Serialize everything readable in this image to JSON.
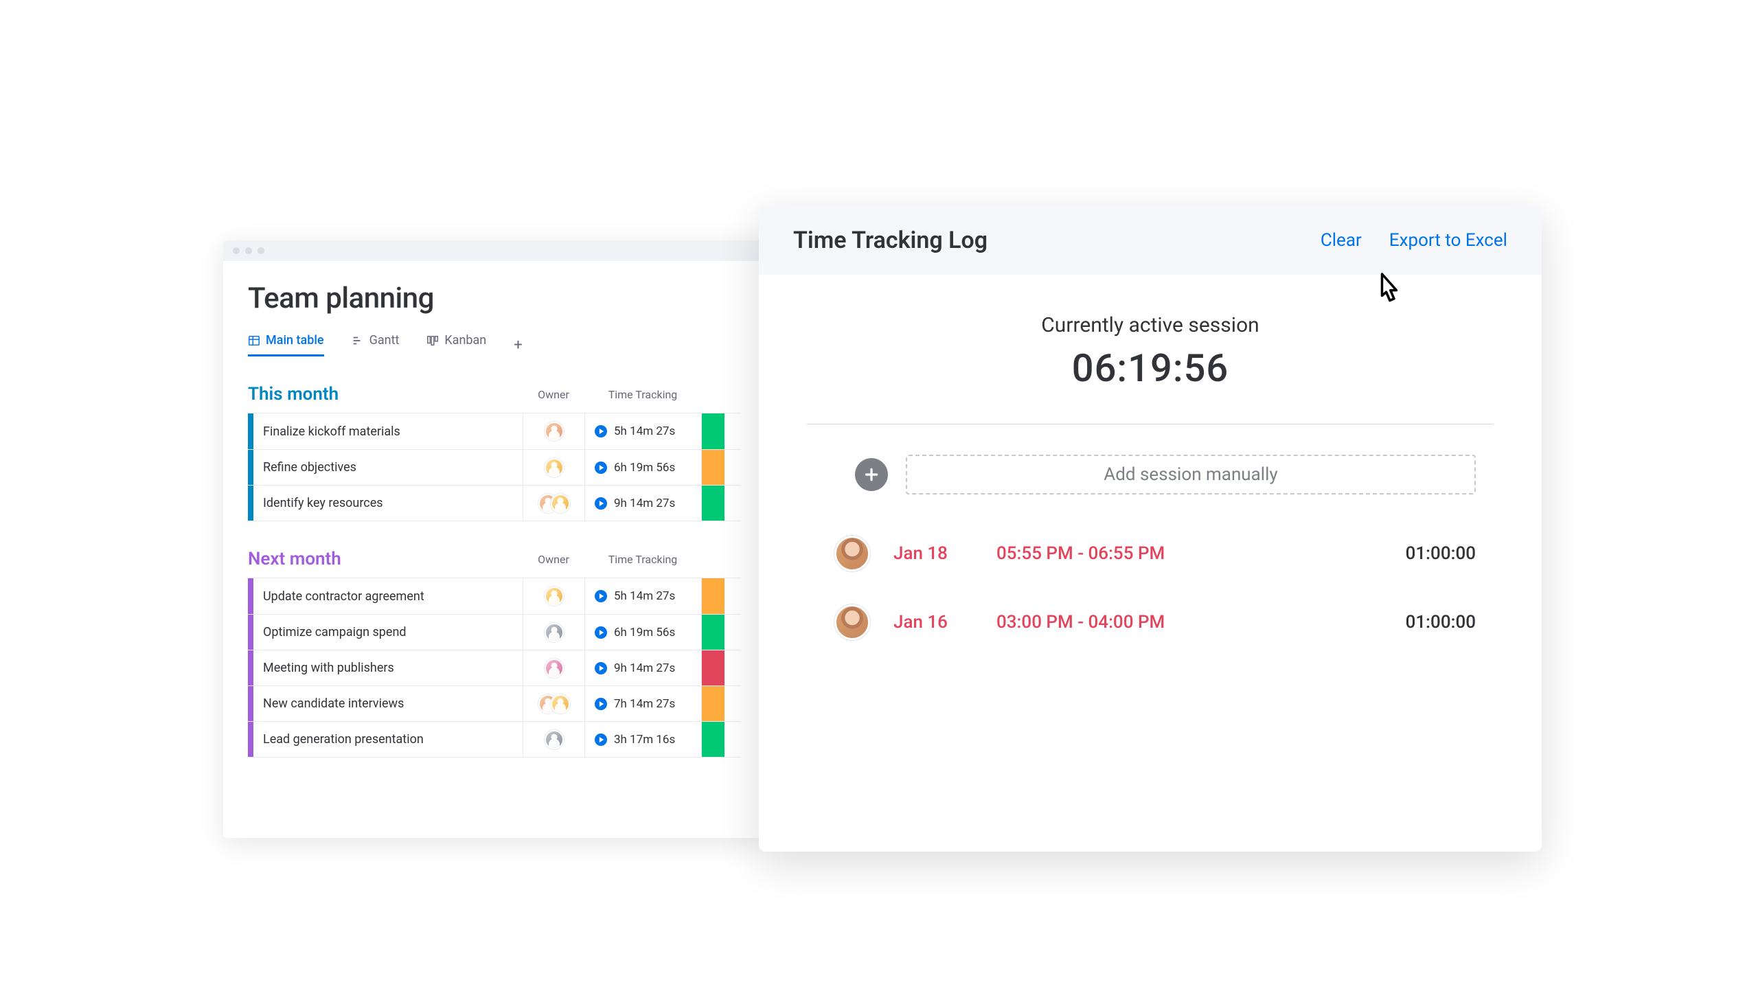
{
  "board": {
    "title": "Team planning",
    "tabs": {
      "main": "Main table",
      "gantt": "Gantt",
      "kanban": "Kanban"
    },
    "columns": {
      "owner": "Owner",
      "time_tracking": "Time Tracking"
    },
    "groups": [
      {
        "id": "this",
        "title": "This month",
        "rows": [
          {
            "name": "Finalize kickoff materials",
            "tt": "5h 14m 27s",
            "owners": [
              "c1"
            ],
            "status": "green"
          },
          {
            "name": "Refine objectives",
            "tt": "6h 19m 56s",
            "owners": [
              "c3"
            ],
            "status": "orange"
          },
          {
            "name": "Identify key resources",
            "tt": "9h 14m 27s",
            "owners": [
              "c1",
              "c3"
            ],
            "status": "green"
          }
        ]
      },
      {
        "id": "next",
        "title": "Next month",
        "rows": [
          {
            "name": "Update contractor agreement",
            "tt": "5h 14m 27s",
            "owners": [
              "c3"
            ],
            "status": "orange"
          },
          {
            "name": "Optimize campaign spend",
            "tt": "6h 19m 56s",
            "owners": [
              "c5"
            ],
            "status": "green"
          },
          {
            "name": "Meeting with publishers",
            "tt": "9h 14m 27s",
            "owners": [
              "c6"
            ],
            "status": "red"
          },
          {
            "name": "New candidate interviews",
            "tt": "7h 14m 27s",
            "owners": [
              "c1",
              "c3"
            ],
            "status": "orange"
          },
          {
            "name": "Lead generation presentation",
            "tt": "3h 17m 16s",
            "owners": [
              "c5"
            ],
            "status": "green"
          }
        ]
      }
    ]
  },
  "panel": {
    "title": "Time Tracking Log",
    "clear": "Clear",
    "export": "Export to Excel",
    "session_label": "Currently active session",
    "session_time": "06:19:56",
    "add_session": "Add session manually",
    "log": [
      {
        "date": "Jan 18",
        "range": "05:55 PM - 06:55 PM",
        "duration": "01:00:00"
      },
      {
        "date": "Jan 16",
        "range": "03:00 PM - 04:00 PM",
        "duration": "01:00:00"
      }
    ]
  },
  "status_colors": {
    "green": "#00c875",
    "orange": "#fdab3d",
    "red": "#e2445c"
  }
}
